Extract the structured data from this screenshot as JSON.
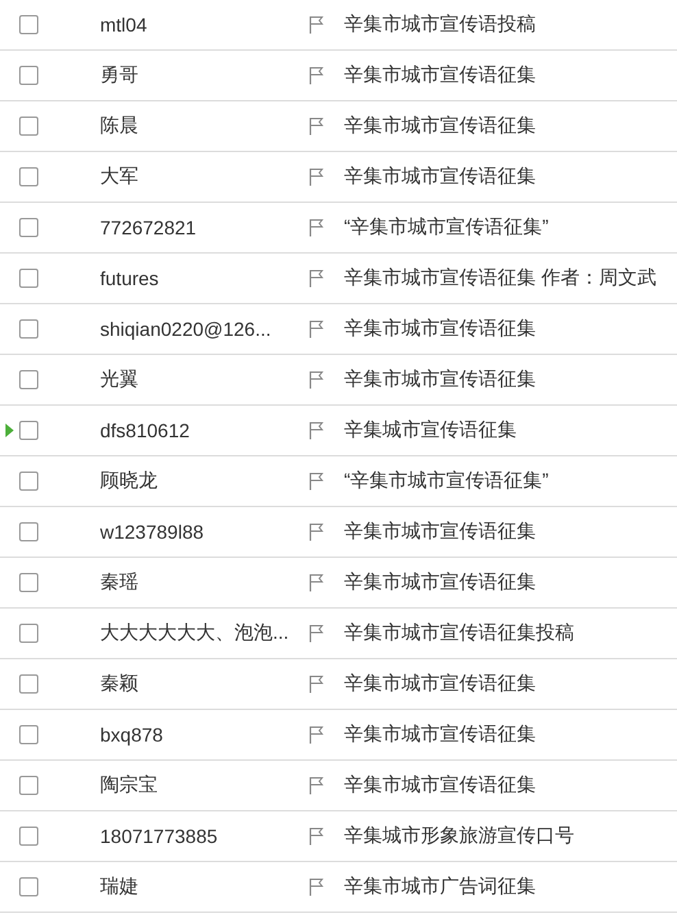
{
  "rows": [
    {
      "sender": "mtl04",
      "subject": "辛集市城市宣传语投稿",
      "checked": false,
      "flagged": false,
      "current": false
    },
    {
      "sender": "勇哥",
      "subject": "辛集市城市宣传语征集",
      "checked": false,
      "flagged": false,
      "current": false
    },
    {
      "sender": "陈晨",
      "subject": "辛集市城市宣传语征集",
      "checked": false,
      "flagged": false,
      "current": false
    },
    {
      "sender": "大军",
      "subject": "辛集市城市宣传语征集",
      "checked": false,
      "flagged": false,
      "current": false
    },
    {
      "sender": "772672821",
      "subject": "“辛集市城市宣传语征集”",
      "checked": false,
      "flagged": false,
      "current": false
    },
    {
      "sender": "futures",
      "subject": "辛集市城市宣传语征集 作者：周文武",
      "checked": false,
      "flagged": false,
      "current": false
    },
    {
      "sender": "shiqian0220@126...",
      "subject": "辛集市城市宣传语征集",
      "checked": false,
      "flagged": false,
      "current": false
    },
    {
      "sender": "光翼",
      "subject": "辛集市城市宣传语征集",
      "checked": false,
      "flagged": false,
      "current": false
    },
    {
      "sender": "dfs810612",
      "subject": "辛集城市宣传语征集",
      "checked": false,
      "flagged": false,
      "current": true
    },
    {
      "sender": "顾晓龙",
      "subject": "“辛集市城市宣传语征集”",
      "checked": false,
      "flagged": false,
      "current": false
    },
    {
      "sender": "w123789l88",
      "subject": "辛集市城市宣传语征集",
      "checked": false,
      "flagged": false,
      "current": false
    },
    {
      "sender": "秦瑶",
      "subject": "辛集市城市宣传语征集",
      "checked": false,
      "flagged": false,
      "current": false
    },
    {
      "sender": "大大大大大大、泡泡...",
      "subject": "辛集市城市宣传语征集投稿",
      "checked": false,
      "flagged": false,
      "current": false
    },
    {
      "sender": "秦颖",
      "subject": "辛集市城市宣传语征集",
      "checked": false,
      "flagged": false,
      "current": false
    },
    {
      "sender": "bxq878",
      "subject": "辛集市城市宣传语征集",
      "checked": false,
      "flagged": false,
      "current": false
    },
    {
      "sender": "陶宗宝",
      "subject": "辛集市城市宣传语征集",
      "checked": false,
      "flagged": false,
      "current": false
    },
    {
      "sender": "18071773885",
      "subject": "辛集城市形象旅游宣传口号",
      "checked": false,
      "flagged": false,
      "current": false
    },
    {
      "sender": "瑞婕",
      "subject": "辛集市城市广告词征集",
      "checked": false,
      "flagged": false,
      "current": false
    }
  ]
}
